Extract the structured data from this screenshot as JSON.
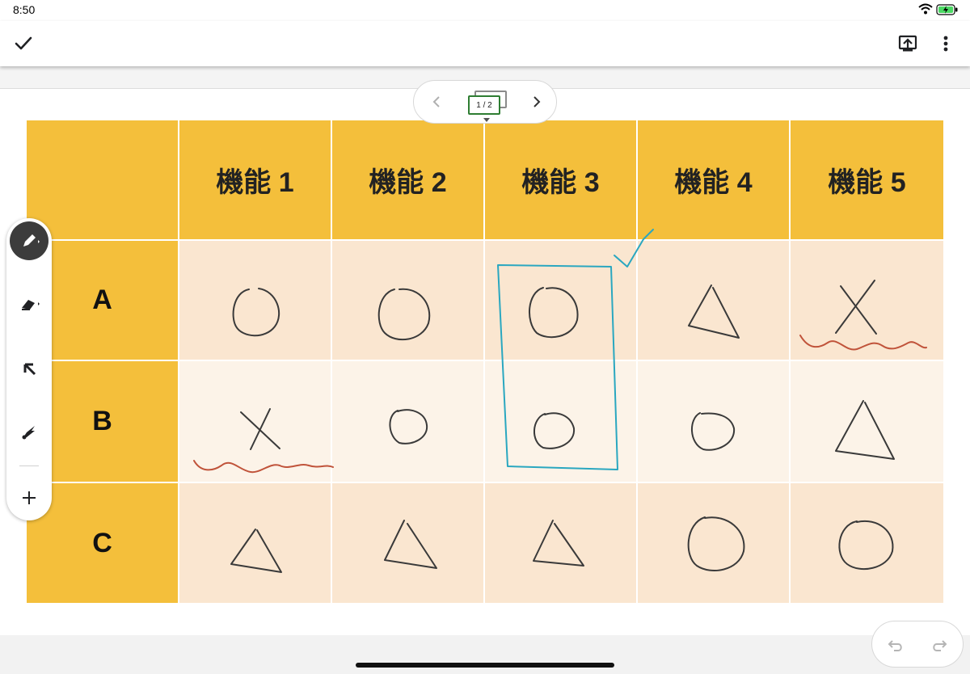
{
  "status_bar": {
    "time": "8:50"
  },
  "pager": {
    "page_indicator": "1 / 2"
  },
  "table": {
    "headers": [
      "機能 1",
      "機能 2",
      "機能 3",
      "機能 4",
      "機能 5"
    ],
    "rows": [
      {
        "label": "A",
        "marks": [
          "circle",
          "circle",
          "circle",
          "triangle",
          "cross"
        ]
      },
      {
        "label": "B",
        "marks": [
          "cross",
          "circle",
          "circle",
          "circle",
          "triangle"
        ]
      },
      {
        "label": "C",
        "marks": [
          "triangle",
          "triangle",
          "triangle",
          "circle",
          "circle"
        ]
      }
    ]
  },
  "toolbar": {
    "tools": [
      "pen-icon",
      "eraser-icon",
      "pointer-icon",
      "laser-icon",
      "add-icon"
    ],
    "active_tool": "pen-icon"
  },
  "colors": {
    "header_fill": "#f4bf3b",
    "row_fill_a_c": "#fae6d0",
    "row_fill_b": "#fcf3e8",
    "ink_black": "#3a3a3a",
    "ink_red": "#c0533a",
    "ink_teal": "#2aa7c0",
    "pager_green": "#2e7d32"
  }
}
